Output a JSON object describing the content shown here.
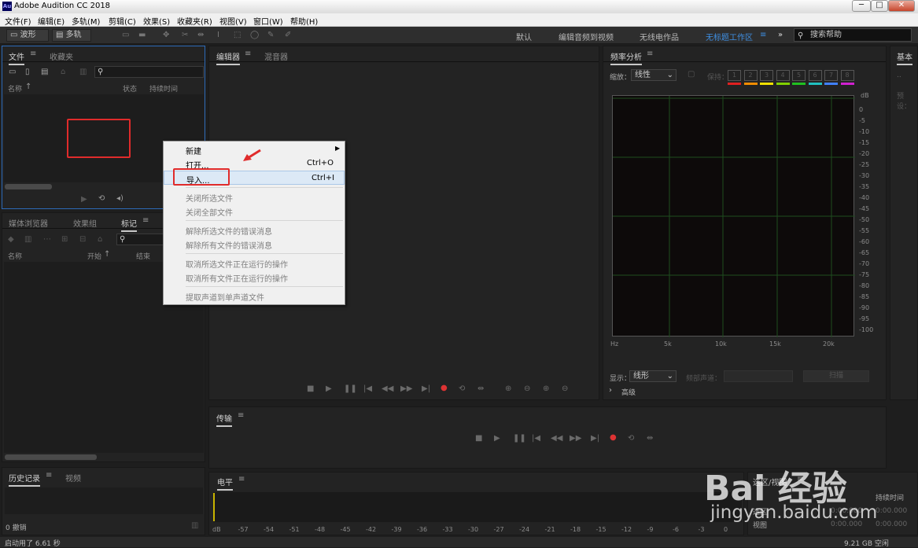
{
  "window": {
    "title": "Adobe Audition CC 2018",
    "logo": "Au",
    "minimize": "─",
    "maximize": "□",
    "close": "✕"
  },
  "menu": [
    "文件(F)",
    "编辑(E)",
    "多轨(M)",
    "剪辑(C)",
    "效果(S)",
    "收藏夹(R)",
    "视图(V)",
    "窗口(W)",
    "帮助(H)"
  ],
  "toolbar": {
    "waveform": "波形",
    "multitrack": "多轨",
    "workspaces": [
      "默认",
      "编辑音频到视频",
      "无线电作品",
      "无标题工作区"
    ],
    "search_placeholder": "搜索帮助"
  },
  "files_panel": {
    "tabs": [
      "文件",
      "收藏夹"
    ],
    "columns": [
      "名称",
      "状态",
      "持续时间"
    ]
  },
  "markers_panel": {
    "tabs": [
      "媒体浏览器",
      "效果组",
      "标记"
    ],
    "columns": [
      "名称",
      "开始",
      "结束"
    ]
  },
  "history_panel": {
    "tabs": [
      "历史记录",
      "视频"
    ],
    "undo": "0 撤销"
  },
  "editor_panel": {
    "tabs": [
      "编辑器",
      "混音器"
    ]
  },
  "transport_panel": {
    "title": "传输"
  },
  "levels_panel": {
    "title": "电平",
    "scale": [
      "dB",
      "-57",
      "-54",
      "-51",
      "-48",
      "-45",
      "-42",
      "-39",
      "-36",
      "-33",
      "-30",
      "-27",
      "-24",
      "-21",
      "-18",
      "-15",
      "-12",
      "-9",
      "-6",
      "-3",
      "0"
    ]
  },
  "freq_panel": {
    "title": "频率分析",
    "zoom_label": "缩放：",
    "zoom_value": "线性",
    "hold_label": "保持：",
    "holds": [
      "1",
      "2",
      "3",
      "4",
      "5",
      "6",
      "7",
      "8"
    ],
    "hold_colors": [
      "#e02020",
      "#f08c00",
      "#f0e000",
      "#80d000",
      "#20c020",
      "#20c0c0",
      "#4080ff",
      "#d020d0"
    ],
    "db_unit": "dB",
    "db_ticks": [
      "0",
      "-5",
      "-10",
      "-15",
      "-20",
      "-25",
      "-30",
      "-35",
      "-40",
      "-45",
      "-50",
      "-55",
      "-60",
      "-65",
      "-70",
      "-75",
      "-80",
      "-85",
      "-90",
      "-95",
      "-100"
    ],
    "hz_ticks": [
      "Hz",
      "5k",
      "10k",
      "15k",
      "20k"
    ],
    "show_label": "显示：",
    "show_value": "线形",
    "channel_label": "频部声道：",
    "scan": "扫描",
    "advanced": "高级"
  },
  "right_panel": {
    "title": "基本",
    "preset": "预设："
  },
  "selection_panel": {
    "title": "选区/视图",
    "duration": "持续时间",
    "selection": "选区",
    "view": "视图",
    "times": [
      "0:00.000",
      "0:00.000",
      "0:00.000",
      "0:00.000"
    ]
  },
  "context_menu": {
    "items": [
      {
        "label": "新建",
        "shortcut": "",
        "submenu": true,
        "disabled": false
      },
      {
        "label": "打开...",
        "shortcut": "Ctrl+O",
        "disabled": false
      },
      {
        "label": "导入...",
        "shortcut": "Ctrl+I",
        "disabled": false,
        "highlighted": true
      },
      {
        "label": "关闭所选文件",
        "shortcut": "",
        "disabled": true
      },
      {
        "label": "关闭全部文件",
        "shortcut": "",
        "disabled": true
      },
      {
        "label": "解除所选文件的错误消息",
        "shortcut": "",
        "disabled": true
      },
      {
        "label": "解除所有文件的错误消息",
        "shortcut": "",
        "disabled": true
      },
      {
        "label": "取消所选文件正在运行的操作",
        "shortcut": "",
        "disabled": true
      },
      {
        "label": "取消所有文件正在运行的操作",
        "shortcut": "",
        "disabled": true
      },
      {
        "label": "提取声道到单声道文件",
        "shortcut": "",
        "disabled": true
      }
    ]
  },
  "status": {
    "startup": "启动用了 6.61 秒",
    "disk": "9.21 GB 空闲"
  },
  "watermark": {
    "text": "Bai 经验",
    "url": "jingyan.baidu.com"
  }
}
